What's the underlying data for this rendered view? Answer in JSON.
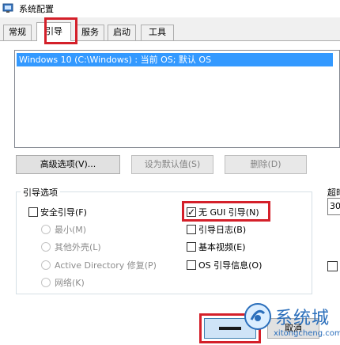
{
  "window": {
    "title": "系统配置"
  },
  "tabs": [
    {
      "label": "常规"
    },
    {
      "label": "引导"
    },
    {
      "label": "服务"
    },
    {
      "label": "启动"
    },
    {
      "label": "工具"
    }
  ],
  "boot_list": {
    "selected_item": "Windows 10 (C:\\Windows) : 当前 OS; 默认 OS"
  },
  "buttons": {
    "advanced": "高级选项(V)...",
    "set_default": "设为默认值(S)",
    "delete": "删除(D)"
  },
  "boot_options": {
    "group_label": "引导选项",
    "safe_boot": "安全引导(F)",
    "minimal": "最小(M)",
    "alternate_shell": "其他外壳(L)",
    "active_directory": "Active Directory 修复(P)",
    "network": "网络(K)",
    "no_gui_boot": "无 GUI 引导(N)",
    "boot_log": "引导日志(B)",
    "base_video": "基本视频(E)",
    "os_boot_info": "OS 引导信息(O)"
  },
  "timeout": {
    "label": "超时",
    "value": "30"
  },
  "watermark": {
    "text": "系统城",
    "url": "xitongcheng.com"
  },
  "bottom_buttons": {
    "cancel": "取消"
  },
  "colors": {
    "highlight": "#d4202a",
    "selection": "#3399ff",
    "accent": "#2a6ebb"
  }
}
